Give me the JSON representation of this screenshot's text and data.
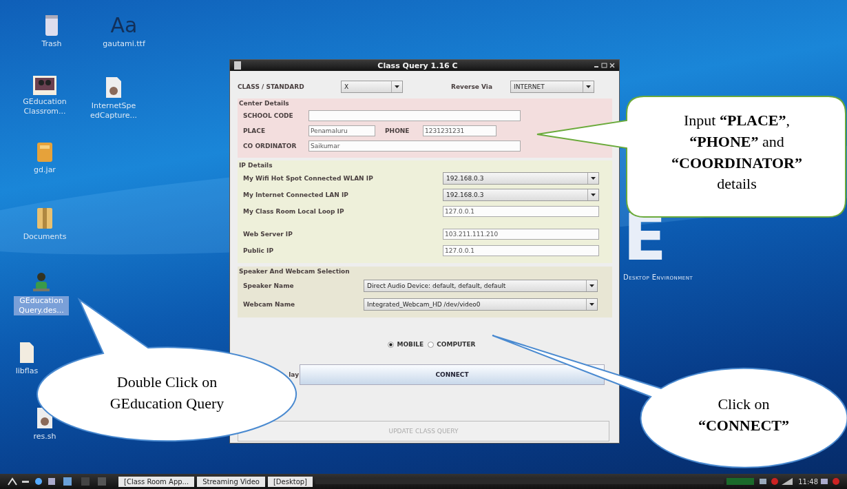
{
  "desktop_icons": [
    {
      "label": "Trash",
      "kind": "trash",
      "selected": false
    },
    {
      "label": "gautami.ttf",
      "kind": "font",
      "glyph": "Aa",
      "selected": false
    },
    {
      "label": "GEducation Classrom...",
      "kind": "classroom",
      "selected": false
    },
    {
      "label": "InternetSpe edCapture...",
      "kind": "script",
      "selected": false
    },
    {
      "label": "gd.jar",
      "kind": "jar",
      "selected": false
    },
    {
      "label": "Documents",
      "kind": "folder",
      "selected": false
    },
    {
      "label": "GEducation Query.des...",
      "kind": "person",
      "selected": true
    },
    {
      "label": "libflas",
      "kind": "file",
      "selected": false
    },
    {
      "label": "res.sh",
      "kind": "script",
      "selected": false
    }
  ],
  "wallpaper": {
    "logo": "E",
    "tagline": "Desktop Environment"
  },
  "window": {
    "title": "Class Query 1.16 C",
    "class_label": "CLASS / STANDARD",
    "class_value": "X",
    "reverse_label": "Reverse Via",
    "reverse_value": "INTERNET",
    "center_details": {
      "title": "Center Details",
      "school_code_label": "SCHOOL CODE",
      "place_label": "PLACE",
      "place_value": "Penamaluru",
      "phone_label": "PHONE",
      "phone_value": "1231231231",
      "coordinator_label": "CO ORDINATOR",
      "coordinator_value": "Saikumar"
    },
    "ip_details": {
      "title": "IP Details",
      "rows": [
        {
          "label": "My Wifi Hot Spot Connected WLAN IP",
          "value": "192.168.0.3",
          "kind": "combo"
        },
        {
          "label": "My Internet Connected LAN IP",
          "value": "192.168.0.3",
          "kind": "combo"
        },
        {
          "label": "My Class Room Local Loop IP",
          "value": "127.0.0.1",
          "kind": "field"
        },
        {
          "label": "Web Server IP",
          "value": "103.211.111.210",
          "kind": "field"
        },
        {
          "label": "Public IP",
          "value": "127.0.0.1",
          "kind": "field"
        }
      ]
    },
    "media": {
      "title": "Speaker And Webcam Selection",
      "rows": [
        {
          "label": "Speaker Name",
          "value": "Direct Audio Device: default, default, default"
        },
        {
          "label": "Webcam Name",
          "value": "Integrated_Webcam_HD /dev/video0"
        }
      ]
    },
    "device_options": [
      {
        "label": "MOBILE",
        "selected": true
      },
      {
        "label": "COMPUTER",
        "selected": false
      }
    ],
    "relay_label": "lay",
    "connect_button": "CONNECT",
    "update_button": {
      "label": "UPDATE CLASS QUERY",
      "disabled": true
    }
  },
  "taskbar": {
    "tasks": [
      "[Class Room App...",
      "Streaming Video",
      "[Desktop]"
    ],
    "clock": "11:48"
  },
  "callouts": [
    {
      "text": "Input **“PLACE”**, **“PHONE”** and **“COORDINATOR”** details",
      "kind": "box"
    },
    {
      "text": "Double Click on GEducation Query",
      "kind": "left"
    },
    {
      "text": "Click on **“CONNECT”**",
      "kind": "right"
    }
  ]
}
